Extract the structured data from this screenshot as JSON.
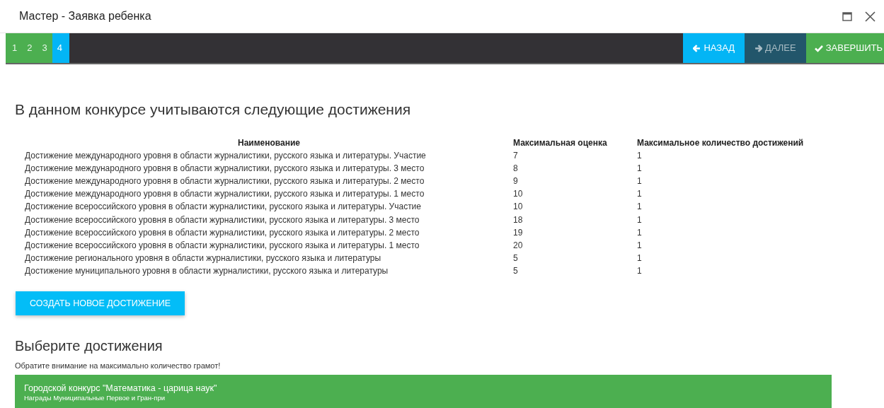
{
  "window": {
    "title": "Мастер - Заявка ребенка"
  },
  "steps": [
    {
      "label": "1",
      "selected": false
    },
    {
      "label": "2",
      "selected": false
    },
    {
      "label": "3",
      "selected": false
    },
    {
      "label": "4",
      "selected": true
    }
  ],
  "nav_buttons": [
    {
      "kind": "back",
      "label": "НАЗАД",
      "disabled": false
    },
    {
      "kind": "next",
      "label": "ДАЛЕЕ",
      "disabled": true
    },
    {
      "kind": "finish",
      "label": "ЗАВЕРШИТЬ",
      "disabled": false
    }
  ],
  "achievements_heading": "В данном конкурсе учитываются следующие достижения",
  "table": {
    "columns": [
      "Наименование",
      "Максимальная оценка",
      "Максимальное количество достижений"
    ],
    "rows": [
      [
        "Достижение международного уровня в области журналистики, русского языка и литературы. Участие",
        "7",
        "1"
      ],
      [
        "Достижение международного уровня в области журналистики, русского языка и литературы. 3 место",
        "8",
        "1"
      ],
      [
        "Достижение международного уровня в области журналистики, русского языка и литературы. 2 место",
        "9",
        "1"
      ],
      [
        "Достижение международного уровня в области журналистики, русского языка и литературы. 1 место",
        "10",
        "1"
      ],
      [
        "Достижение всероссийского уровня в области журналистики, русского языка и литературы. Участие",
        "10",
        "1"
      ],
      [
        "Достижение всероссийского уровня в области журналистики, русского языка и литературы. 3 место",
        "18",
        "1"
      ],
      [
        "Достижение всероссийского уровня в области журналистики, русского языка и литературы. 2 место",
        "19",
        "1"
      ],
      [
        "Достижение всероссийского уровня в области журналистики, русского языка и литературы. 1 место",
        "20",
        "1"
      ],
      [
        "Достижение регионального уровня в области журналистики, русского языка и литературы",
        "5",
        "1"
      ],
      [
        "Достижение муниципального уровня в области журналистики, русского языка и литературы",
        "5",
        "1"
      ]
    ]
  },
  "create_button": "СОЗДАТЬ НОВОЕ ДОСТИЖЕНИЕ",
  "select_heading": "Выберите достижения",
  "select_note": "Обратите внимание на максимально количество грамот!",
  "items": [
    {
      "title": "Городской конкурс \"Математика - царица наук\"",
      "subtitle": "Награды Муниципальные Первое и Гран-при"
    }
  ]
}
